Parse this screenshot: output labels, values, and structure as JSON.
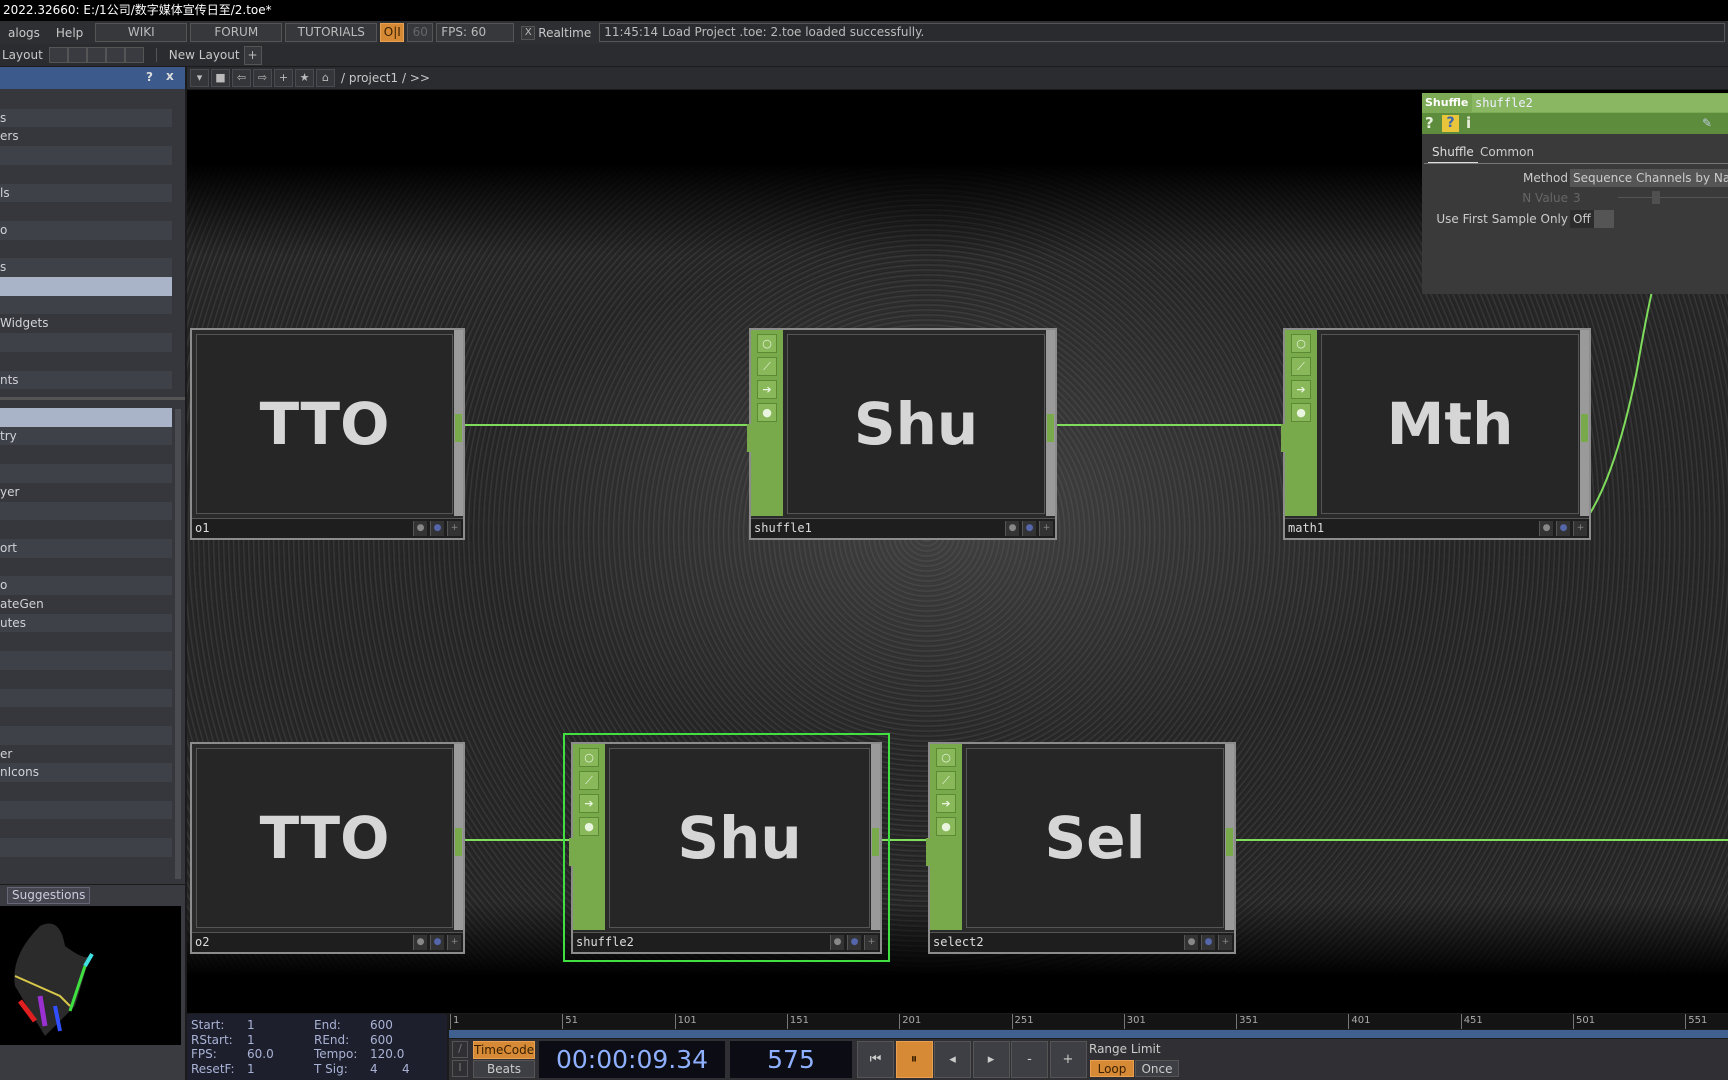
{
  "window": {
    "title": "2022.32660: E:/1公司/数字媒体宣传日至/2.toe*"
  },
  "menu": {
    "items": [
      "alogs",
      "Help"
    ],
    "wiki": "WIKI",
    "forum": "FORUM",
    "tutorials": "TUTORIALS",
    "oi": "O|I",
    "fps_cap": "60",
    "fps_label": "FPS:  60",
    "realtime_check": "X",
    "realtime": "Realtime",
    "status": "11:45:14 Load Project .toe: 2.toe loaded successfully."
  },
  "layoutbar": {
    "layout": "Layout",
    "new_layout": "New Layout",
    "add": "+"
  },
  "panehdr": {
    "help": "?",
    "close": "x"
  },
  "netbar": {
    "path": "/ project1 / >>",
    "buttons": [
      "▾",
      "■",
      "⇦",
      "⇨",
      "+",
      "★",
      "⌂"
    ]
  },
  "left_list_top": [
    "",
    "s",
    "ers",
    "",
    "",
    "ls",
    "",
    "o",
    "",
    "s",
    "",
    "",
    "Widgets",
    "",
    "",
    "nts"
  ],
  "left_list_top_highlight": 10,
  "left_list_bottom": [
    "",
    "try",
    "",
    "",
    "yer",
    "",
    "",
    "ort",
    "",
    "o",
    "ateGen",
    "utes",
    "",
    "",
    "",
    "",
    "",
    "",
    "er",
    "nIcons",
    "",
    "",
    "",
    "",
    ""
  ],
  "left_list_bottom_highlight": 0,
  "suggestions": {
    "tab": "Suggestions"
  },
  "nodes": [
    {
      "title": "TTO",
      "name": "o1",
      "type": "top"
    },
    {
      "title": "Shu",
      "name": "shuffle1",
      "type": "chop"
    },
    {
      "title": "Mth",
      "name": "math1",
      "type": "chop"
    },
    {
      "title": "TTO",
      "name": "o2",
      "type": "top"
    },
    {
      "title": "Shu",
      "name": "shuffle2",
      "type": "chop",
      "selected": true
    },
    {
      "title": "Sel",
      "name": "select2",
      "type": "chop"
    }
  ],
  "params": {
    "type": "Shuffle",
    "name": "shuffle2",
    "help": "?",
    "python_help": "?",
    "info": "i",
    "tabs": [
      "Shuffle",
      "Common"
    ],
    "active_tab": "Shuffle",
    "method_label": "Method",
    "method_value": "Sequence Channels by Nam",
    "nvalue_label": "N Value",
    "nvalue_value": "3",
    "first_sample_label": "Use First Sample Only",
    "first_sample_value": "Off"
  },
  "timeinfo": {
    "start_l": "Start:",
    "start": "1",
    "end_l": "End:",
    "end": "600",
    "rstart_l": "RStart:",
    "rstart": "1",
    "rend_l": "REnd:",
    "rend": "600",
    "fps_l": "FPS:",
    "fps": "60.0",
    "tempo_l": "Tempo:",
    "tempo": "120.0",
    "resetf_l": "ResetF:",
    "resetf": "1",
    "tsig_l": "T Sig:",
    "tsig1": "4",
    "tsig2": "4"
  },
  "ruler": [
    "1",
    "51",
    "101",
    "151",
    "201",
    "251",
    "301",
    "351",
    "401",
    "451",
    "501",
    "551"
  ],
  "transport": {
    "timecode": "TimeCode",
    "beats": "Beats",
    "time": "00:00:09.34",
    "frame": "575",
    "buttons": [
      "⏮",
      "⏸",
      "◂",
      "▸",
      "-",
      "+"
    ],
    "range_limit": "Range Limit",
    "loop": "Loop",
    "once": "Once",
    "slash": "/",
    "i": "I"
  },
  "colors": {
    "accent_orange": "#d68a35",
    "chop_green": "#78a94a",
    "wire_green": "#7fdc5c",
    "pane_blue": "#3d5a8c",
    "timecode_blue": "#8fb0ff"
  }
}
